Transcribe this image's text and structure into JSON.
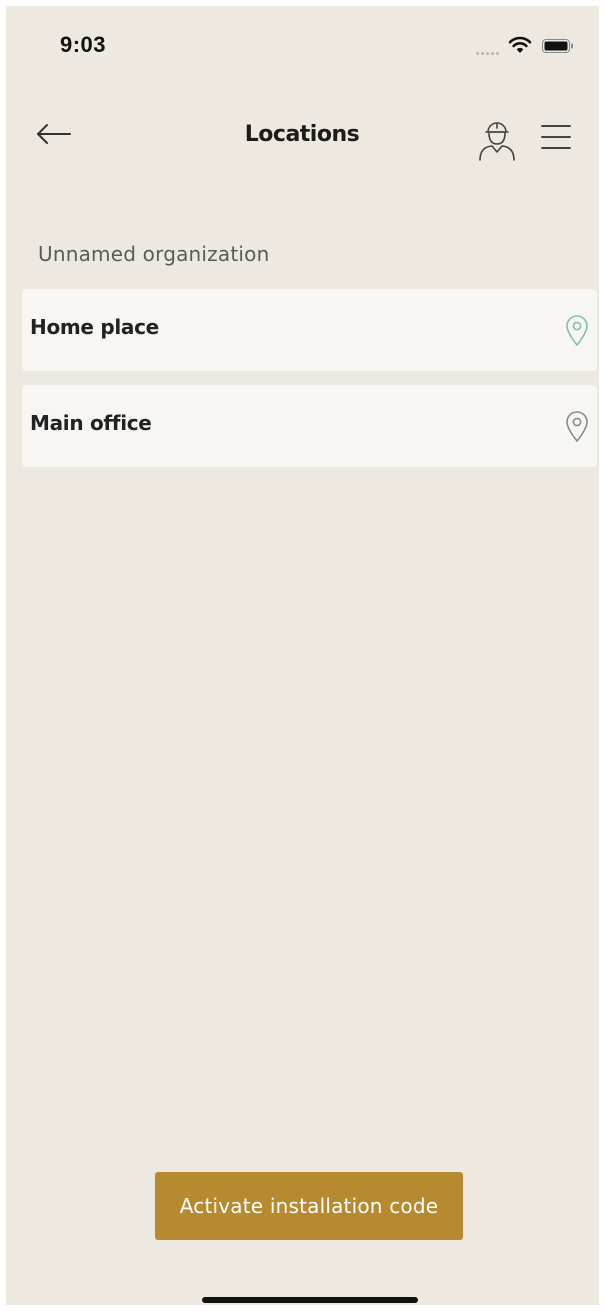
{
  "status_bar": {
    "time": "9:03",
    "icons": [
      "signal-dots-icon",
      "wifi-icon",
      "battery-icon"
    ]
  },
  "nav": {
    "title": "Locations",
    "back_icon": "back-arrow-icon",
    "installer_icon": "installer-worker-icon",
    "menu_icon": "hamburger-menu-icon"
  },
  "organization": {
    "name": "Unnamed organization"
  },
  "locations": [
    {
      "name": "Home place",
      "icon": "location-pin-icon",
      "pin_color": "#7cc4a0"
    },
    {
      "name": "Main office",
      "icon": "location-pin-icon",
      "pin_color": "#8a8a8a"
    }
  ],
  "actions": {
    "activate_label": "Activate installation code"
  },
  "colors": {
    "background": "#ede9e0",
    "card": "#f7f6f3",
    "accent": "#b78a2f",
    "active_pin": "#7cc4a0",
    "inactive_pin": "#8a8a8a"
  }
}
